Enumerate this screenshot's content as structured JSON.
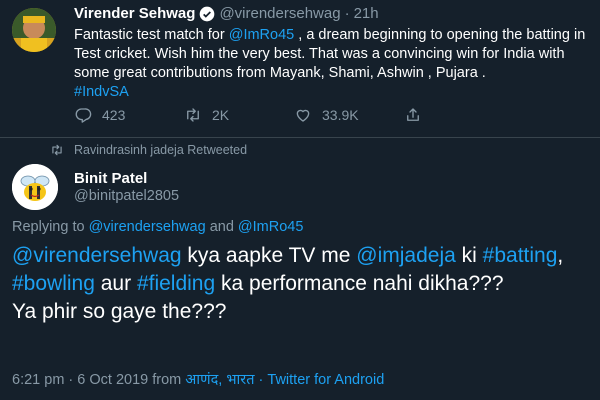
{
  "tweet": {
    "author_name": "Virender Sehwag",
    "author_handle": "@virendersehwag",
    "separator": "·",
    "time": "21h",
    "avatar_icon": "profile-photo-icon",
    "body": {
      "p1": "Fantastic test match for ",
      "mention1": "@ImRo45",
      "p2": " , a dream beginning to opening the batting in Test cricket. Wish him the very best. That was a convincing win for India with some great contributions from Mayank, Shami, Ashwin , Pujara .",
      "hashtag": "#IndvSA"
    },
    "actions": {
      "reply_count": "423",
      "retweet_count": "2K",
      "like_count": "33.9K"
    }
  },
  "retweet_notice": {
    "text": "Ravindrasinh jadeja Retweeted"
  },
  "reply_tweet": {
    "author_name": "Binit Patel",
    "author_handle": "@binitpatel2805",
    "replying": {
      "prefix": "Replying to ",
      "mention1": "@virendersehwag",
      "and": " and ",
      "mention2": "@ImRo45"
    },
    "body": {
      "mention1": "@virendersehwag",
      "t1": " kya aapke TV me ",
      "mention2": "@imjadeja",
      "t2": " ki ",
      "hashtag1": "#batting",
      "t3": ", ",
      "hashtag2": "#bowling",
      "t4": " aur ",
      "hashtag3": "#fielding",
      "t5": " ka performance nahi dikha???",
      "line2": "Ya phir so gaye the???"
    },
    "meta": {
      "time": "6:21 pm",
      "sep1": " · ",
      "date": "6 Oct 2019",
      "from": " from ",
      "location": "आणंद, भारत",
      "sep2": " · ",
      "source": "Twitter for Android"
    }
  },
  "colors": {
    "background": "#15202b",
    "link": "#1da1f2",
    "muted": "#8899a6",
    "divider": "#38444d"
  }
}
